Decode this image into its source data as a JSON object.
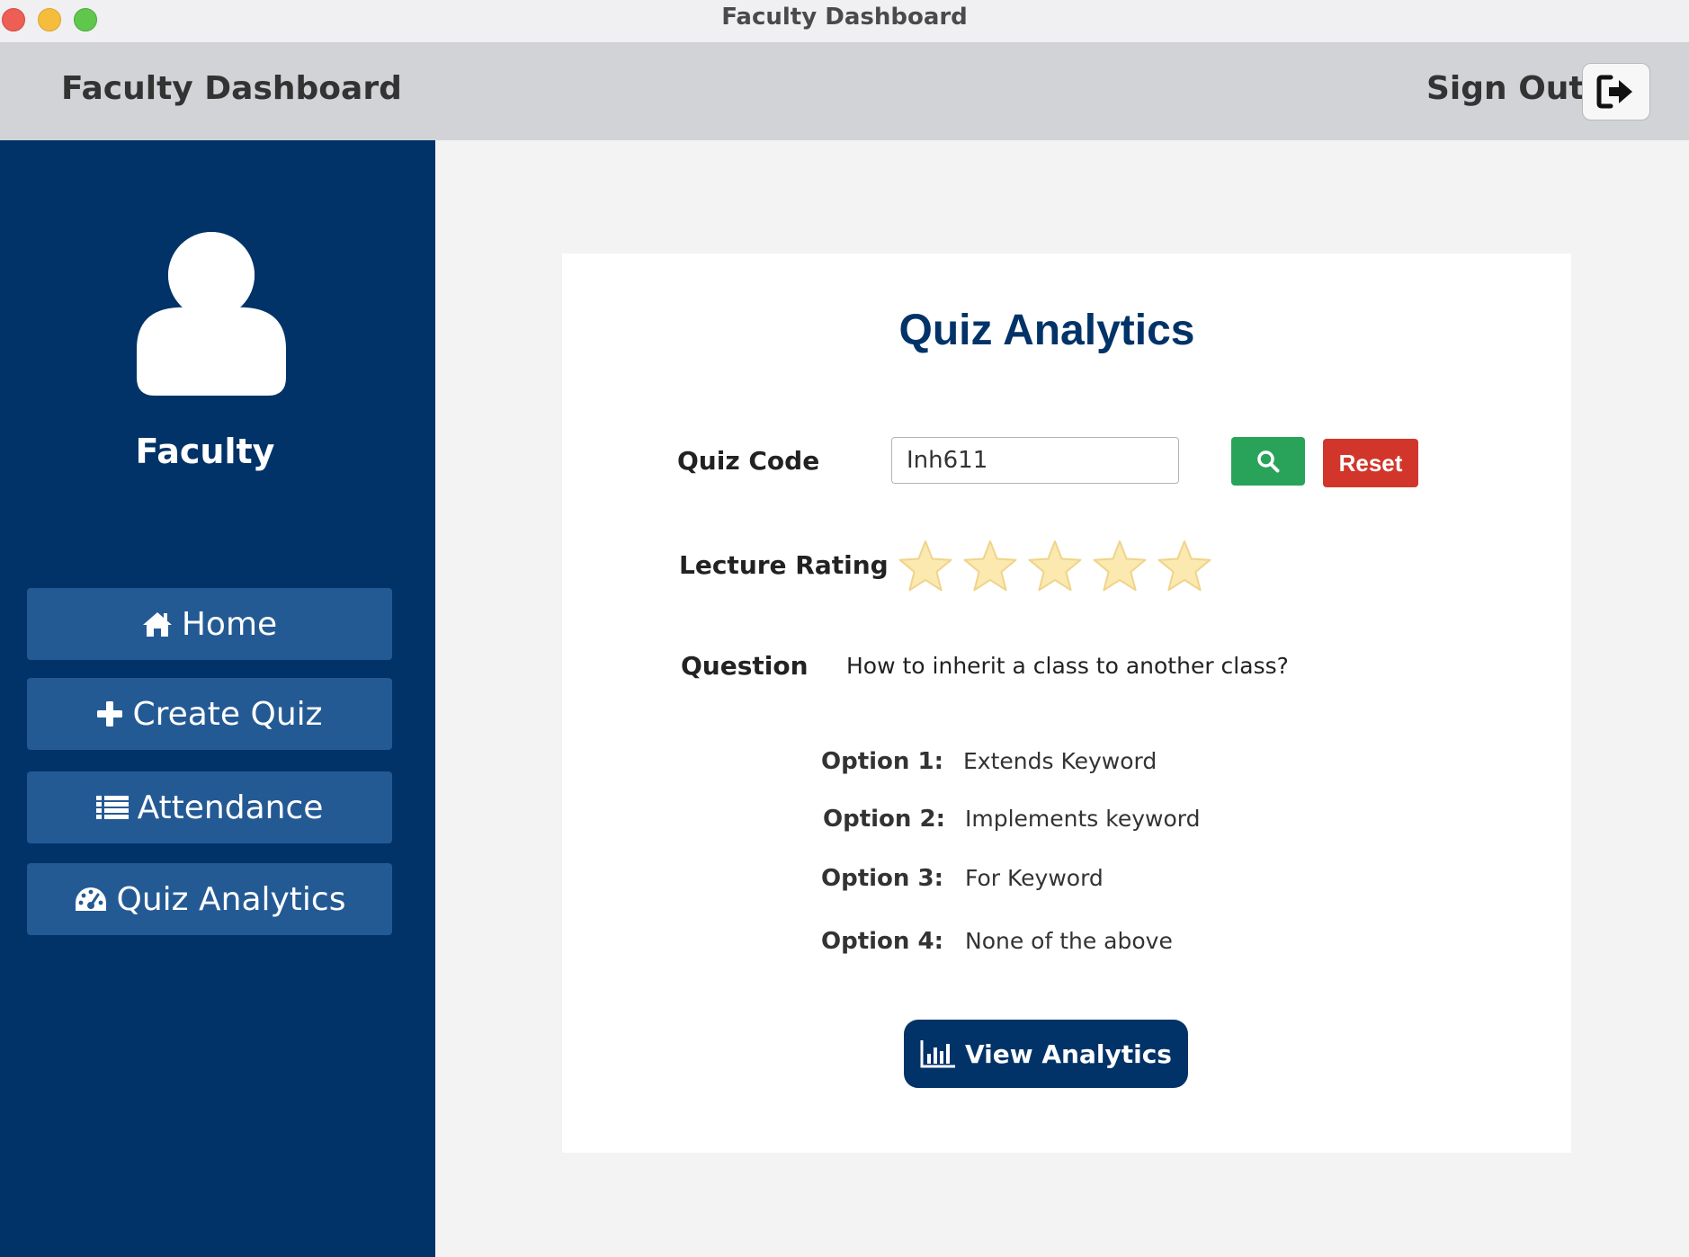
{
  "window": {
    "title": "Faculty Dashboard"
  },
  "header": {
    "title": "Faculty Dashboard",
    "signout_label": "Sign Out",
    "signout_icon": "sign-out-icon"
  },
  "sidebar": {
    "user_label": "Faculty",
    "avatar_icon": "user-avatar-icon",
    "items": [
      {
        "label": "Home",
        "icon": "home-icon"
      },
      {
        "label": "Create Quiz",
        "icon": "plus-icon"
      },
      {
        "label": "Attendance",
        "icon": "list-icon"
      },
      {
        "label": "Quiz Analytics",
        "icon": "dashboard-icon"
      }
    ]
  },
  "main": {
    "title": "Quiz Analytics",
    "quiz_code_label": "Quiz Code",
    "quiz_code_value": "Inh611",
    "search_icon": "search-icon",
    "reset_label": "Reset",
    "rating_label": "Lecture Rating",
    "rating": {
      "value": 0,
      "max": 5
    },
    "question_label": "Question",
    "question_text": "How to inherit a class to another class?",
    "options": [
      {
        "label": "Option 1:",
        "value": "Extends Keyword"
      },
      {
        "label": "Option 2:",
        "value": "Implements keyword"
      },
      {
        "label": "Option 3:",
        "value": "For Keyword"
      },
      {
        "label": "Option 4:",
        "value": "None of the above"
      }
    ],
    "view_analytics_label": "View Analytics",
    "view_analytics_icon": "bar-chart-icon"
  },
  "colors": {
    "sidebar_bg": "#023368",
    "nav_button_bg": "#245a94",
    "header_bg": "#d1d3d7",
    "search_button": "#2aa35a",
    "reset_button": "#d2362b",
    "primary": "#023368"
  }
}
